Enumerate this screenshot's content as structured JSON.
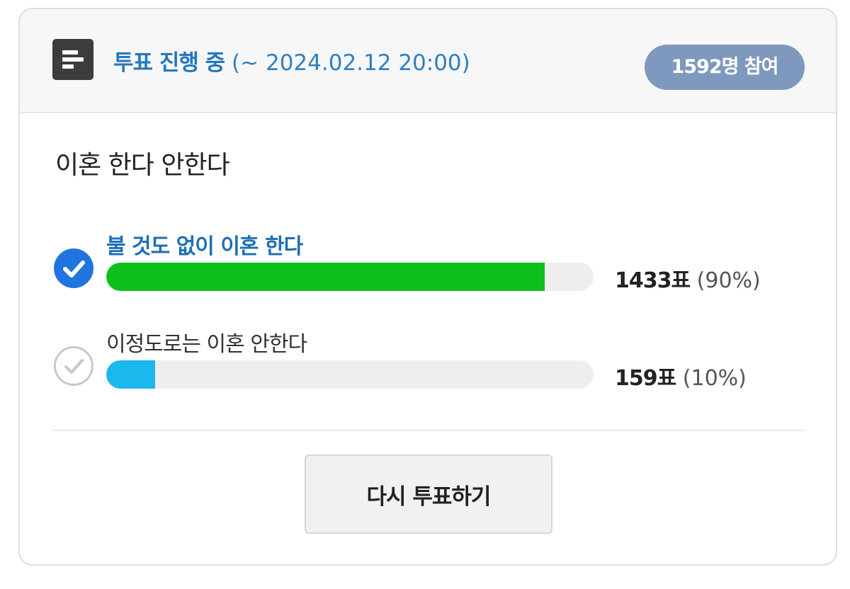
{
  "header": {
    "status_label": "투표 진행 중",
    "deadline": "(~ 2024.02.12 20:00)",
    "participants_badge": "1592명 참여",
    "icon": "poll-list-icon"
  },
  "poll": {
    "question": "이혼 한다 안한다",
    "options": [
      {
        "label": "불 것도 없이 이혼 한다",
        "votes": "1433표",
        "percent": "(90%)",
        "fraction": 0.9,
        "selected": true,
        "bar_color": "#0ec01b",
        "check_icon": "check-circle-filled-icon"
      },
      {
        "label": "이정도로는 이혼 안한다",
        "votes": "159표",
        "percent": "(10%)",
        "fraction": 0.1,
        "selected": false,
        "bar_color": "#1ab8ec",
        "check_icon": "check-circle-outline-icon"
      }
    ]
  },
  "actions": {
    "revote_label": "다시 투표하기"
  },
  "colors": {
    "accent": "#2678bd",
    "badge": "#7f98bd",
    "selected_check": "#1f75dd"
  }
}
